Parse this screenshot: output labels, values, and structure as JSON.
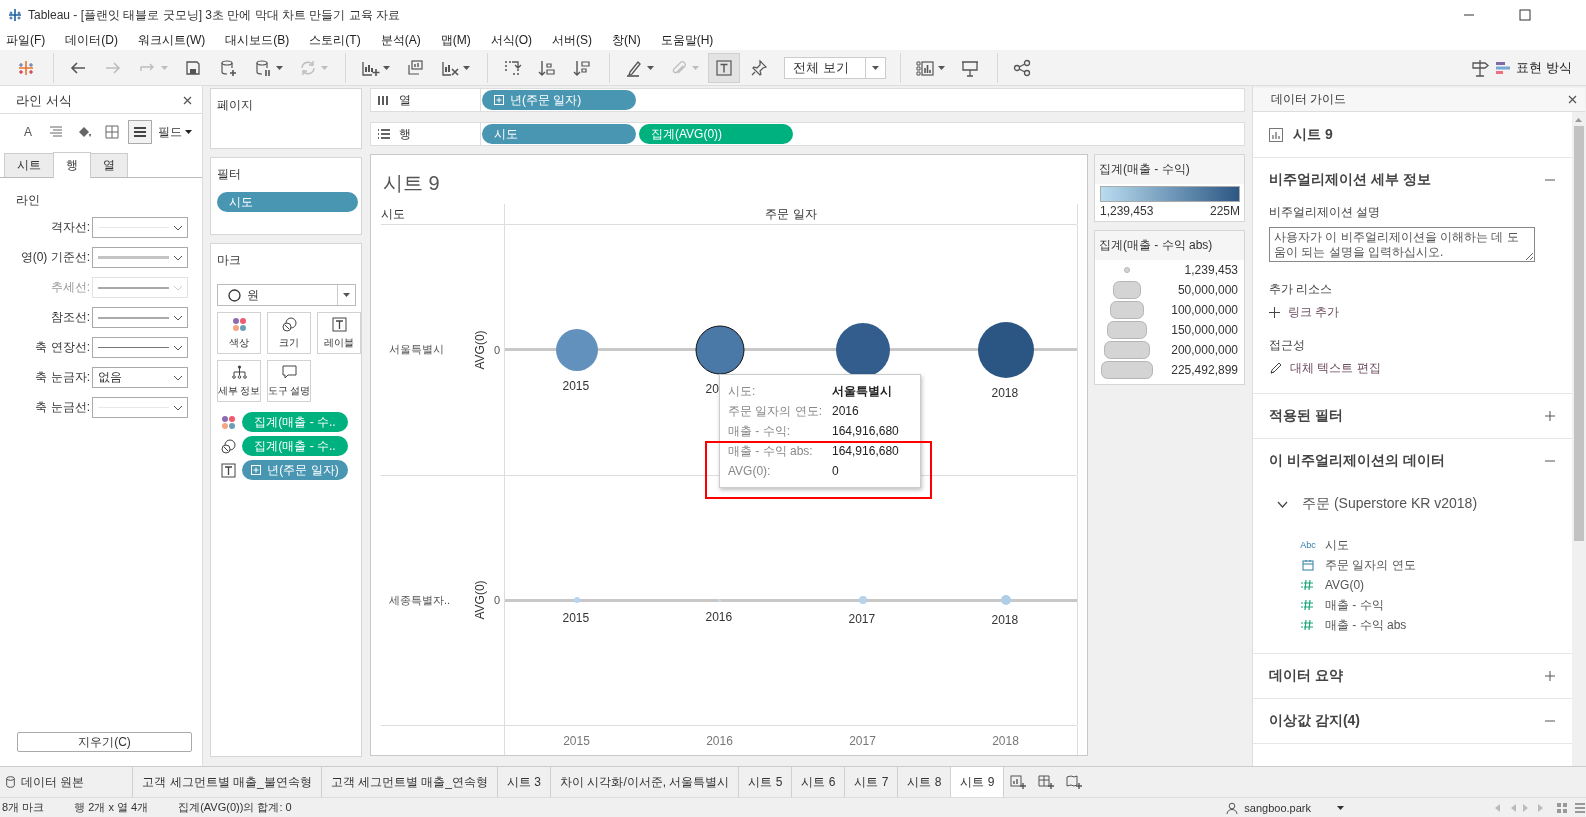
{
  "window": {
    "title": "Tableau - [플랜잇 태블로 굿모닝] 3초 만에 막대 차트 만들기 교육 자료"
  },
  "menu": [
    "파일(F)",
    "데이터(D)",
    "워크시트(W)",
    "대시보드(B)",
    "스토리(T)",
    "분석(A)",
    "맵(M)",
    "서식(O)",
    "서버(S)",
    "창(N)",
    "도움말(H)"
  ],
  "toolbar": {
    "items": [
      {
        "kind": "logo"
      },
      {
        "kind": "separator"
      },
      {
        "kind": "back",
        "disabled": false,
        "menu": false,
        "selected": false
      },
      {
        "kind": "forward",
        "disabled": true,
        "menu": false,
        "selected": false
      },
      {
        "kind": "replay",
        "disabled": true,
        "menu": true,
        "selected": false
      },
      {
        "kind": "save",
        "disabled": false,
        "menu": false,
        "selected": false
      },
      {
        "kind": "new-datasource",
        "disabled": false,
        "menu": false,
        "selected": false
      },
      {
        "kind": "pause",
        "disabled": false,
        "menu": true,
        "selected": false
      },
      {
        "kind": "refresh",
        "disabled": true,
        "menu": true,
        "selected": false
      },
      {
        "kind": "separator"
      },
      {
        "kind": "new-sheet",
        "disabled": false,
        "menu": true,
        "selected": false
      },
      {
        "kind": "duplicate",
        "disabled": false,
        "menu": false,
        "selected": false
      },
      {
        "kind": "clear",
        "disabled": false,
        "menu": true,
        "selected": false
      },
      {
        "kind": "separator"
      },
      {
        "kind": "swap",
        "disabled": false,
        "menu": false,
        "selected": false
      },
      {
        "kind": "sort-asc",
        "disabled": false,
        "menu": false,
        "selected": false
      },
      {
        "kind": "sort-desc",
        "disabled": false,
        "menu": false,
        "selected": false
      },
      {
        "kind": "separator"
      },
      {
        "kind": "highlight",
        "disabled": false,
        "menu": true,
        "selected": false
      },
      {
        "kind": "attach",
        "disabled": true,
        "menu": true,
        "selected": false
      },
      {
        "kind": "labels",
        "disabled": false,
        "menu": false,
        "selected": true
      },
      {
        "kind": "pin",
        "disabled": false,
        "menu": false,
        "selected": false
      },
      {
        "kind": "view-select",
        "label": "전체 보기"
      },
      {
        "kind": "separator"
      },
      {
        "kind": "chart-size",
        "disabled": false,
        "menu": true,
        "selected": false
      },
      {
        "kind": "presentation",
        "disabled": false,
        "menu": false,
        "selected": false
      },
      {
        "kind": "separator"
      },
      {
        "kind": "share",
        "disabled": false,
        "menu": false,
        "selected": false
      }
    ],
    "show_me": "표현 방식"
  },
  "format_pane": {
    "title": "라인 서식",
    "field_menu": "필드",
    "tools": [
      {
        "kind": "font",
        "label": "A",
        "selected": false
      },
      {
        "kind": "align",
        "selected": false
      },
      {
        "kind": "shading",
        "selected": false
      },
      {
        "kind": "borders",
        "selected": false
      },
      {
        "kind": "lines",
        "selected": true
      }
    ],
    "tabs": [
      {
        "label": "시트",
        "selected": false
      },
      {
        "label": "행",
        "selected": true
      },
      {
        "label": "열",
        "selected": false
      }
    ],
    "section": "라인",
    "rows": [
      {
        "label": "격자선:",
        "kind": "faint",
        "disabled": false
      },
      {
        "label": "영(0) 기준선:",
        "kind": "thick",
        "disabled": false
      },
      {
        "label": "추세선:",
        "kind": "medium",
        "disabled": true
      },
      {
        "label": "참조선:",
        "kind": "medium",
        "disabled": false
      },
      {
        "label": "축 연장선:",
        "kind": "thin",
        "disabled": false
      },
      {
        "label": "축 눈금자:",
        "kind": "text",
        "value": "없음",
        "disabled": false
      },
      {
        "label": "축 눈금선:",
        "kind": "faint",
        "disabled": false
      }
    ],
    "clear_button": "지우기(C)"
  },
  "pages": {
    "title": "페이지"
  },
  "filters": {
    "title": "필터",
    "pills": [
      {
        "label": "시도",
        "measure": false,
        "expand_icon": false
      }
    ]
  },
  "marks": {
    "title": "마크",
    "type": "원",
    "buttons": [
      {
        "label": "색상",
        "kind": "color"
      },
      {
        "label": "크기",
        "kind": "size"
      },
      {
        "label": "레이블",
        "kind": "label"
      },
      {
        "label": "세부 정보",
        "kind": "detail"
      },
      {
        "label": "도구 설명",
        "kind": "tooltip"
      }
    ],
    "pills": [
      {
        "kind": "color",
        "label": "집계(매출 - 수..",
        "measure": true,
        "expand_icon": false
      },
      {
        "kind": "size",
        "label": "집계(매출 - 수..",
        "measure": true,
        "expand_icon": false
      },
      {
        "kind": "label",
        "label": "년(주문 일자)",
        "measure": false,
        "expand_icon": true
      }
    ]
  },
  "columns_shelf": {
    "label": "열",
    "pills": [
      {
        "label": "년(주문 일자)",
        "measure": false,
        "expand_icon": true
      }
    ]
  },
  "rows_shelf": {
    "label": "행",
    "pills": [
      {
        "label": "시도",
        "measure": false,
        "expand_icon": false
      },
      {
        "label": "집계(AVG(0))",
        "measure": true,
        "expand_icon": false
      }
    ]
  },
  "viz": {
    "title": "시트 9",
    "row_header": "시도",
    "column_header": "주문 일자",
    "rows": [
      {
        "label": "서울특별시",
        "axis_title": "AVG(0)",
        "tick": "0",
        "marks": [
          {
            "label": "2015",
            "color": "#6391bd",
            "kind": "medium",
            "selected": false
          },
          {
            "label": "20",
            "color": "#4a78a7",
            "kind": "large",
            "selected": true
          },
          {
            "color": "#325d8d",
            "kind": "huge",
            "selected": false
          },
          {
            "label": "2018",
            "color": "#2b5683",
            "kind": "giant",
            "selected": false
          }
        ]
      },
      {
        "label": "세종특별자..",
        "axis_title": "AVG(0)",
        "tick": "0",
        "marks": [
          {
            "label": "2015",
            "color": "#b8d5ec",
            "kind": "tiny",
            "selected": false
          },
          {
            "label": "2016",
            "color": "#c4dcef",
            "kind": "speck",
            "selected": false
          },
          {
            "label": "2017",
            "color": "#b5d3eb",
            "kind": "small",
            "selected": false
          },
          {
            "label": "2018",
            "color": "#afcfe9",
            "kind": "little",
            "selected": false
          }
        ]
      }
    ],
    "x_axis": [
      "2015",
      "2016",
      "2017",
      "2018"
    ],
    "tooltip": {
      "rows": [
        {
          "key": "시도:",
          "value": "서울특별시",
          "bold": true,
          "highlighted": false
        },
        {
          "key": "주문 일자의 연도:",
          "value": "2016",
          "bold": false,
          "highlighted": false
        },
        {
          "key": "매출 - 수익:",
          "value": "164,916,680",
          "bold": false,
          "highlighted": false
        },
        {
          "key": "매출 - 수익 abs:",
          "value": "164,916,680",
          "bold": false,
          "highlighted": true
        },
        {
          "key": "AVG(0):",
          "value": "0",
          "bold": false,
          "highlighted": true
        }
      ]
    }
  },
  "color_legend": {
    "title": "집계(매출 - 수익)",
    "min": "1,239,453",
    "max": "225M"
  },
  "size_legend": {
    "title": "집계(매출 - 수익 abs)",
    "items": [
      "1,239,453",
      "50,000,000",
      "100,000,000",
      "150,000,000",
      "200,000,000",
      "225,492,899"
    ]
  },
  "guide": {
    "title": "데이터 가이드",
    "sheet": "시트 9",
    "details": {
      "title": "비주얼리제이션 세부 정보",
      "expanded": true,
      "description_label": "비주얼리제이션 설명",
      "description_placeholder": "사용자가 이 비주얼리제이션을 이해하는 데 도움이 되는 설명을 입력하십시오.",
      "resources_label": "추가 리소스",
      "add_link": "링크 추가",
      "accessibility_label": "접근성",
      "alt_text": "대체 텍스트 편집"
    },
    "filters": {
      "title": "적용된 필터",
      "expanded": false
    },
    "data": {
      "title": "이 비주얼리제이션의 데이터",
      "expanded": true,
      "source": {
        "label": "주문 (Superstore KR v2018)",
        "expanded": true,
        "fields": [
          {
            "kind": "text",
            "icon_text": "Abc",
            "label": "시도"
          },
          {
            "kind": "date",
            "label": "주문 일자의 연도"
          },
          {
            "kind": "number",
            "label": "AVG(0)"
          },
          {
            "kind": "number",
            "label": "매출 - 수익"
          },
          {
            "kind": "number",
            "label": "매출 - 수익 abs"
          }
        ]
      }
    },
    "summary": {
      "title": "데이터 요약",
      "expanded": false
    },
    "outliers": {
      "title": "이상값 감지(4)",
      "expanded": true
    }
  },
  "sheet_tabs": [
    {
      "label": "데이터 원본",
      "kind": "datasource",
      "selected": false
    },
    {
      "label": "고객 세그먼트별 매출_불연속형",
      "kind": "sheet",
      "selected": false
    },
    {
      "label": "고객 세그먼트별 매출_연속형",
      "kind": "sheet",
      "selected": false
    },
    {
      "label": "시트 3",
      "kind": "sheet",
      "selected": false
    },
    {
      "label": "차이 시각화/이서준, 서울특별시",
      "kind": "sheet",
      "selected": false
    },
    {
      "label": "시트 5",
      "kind": "sheet",
      "selected": false
    },
    {
      "label": "시트 6",
      "kind": "sheet",
      "selected": false
    },
    {
      "label": "시트 7",
      "kind": "sheet",
      "selected": false
    },
    {
      "label": "시트 8",
      "kind": "sheet",
      "selected": false
    },
    {
      "label": "시트 9",
      "kind": "sheet",
      "selected": true
    }
  ],
  "status": {
    "marks": "8개 마크",
    "grid": "행 2개 x 열 4개",
    "sum": "집계(AVG(0))의 합계: 0",
    "user": "sangboo.park"
  }
}
